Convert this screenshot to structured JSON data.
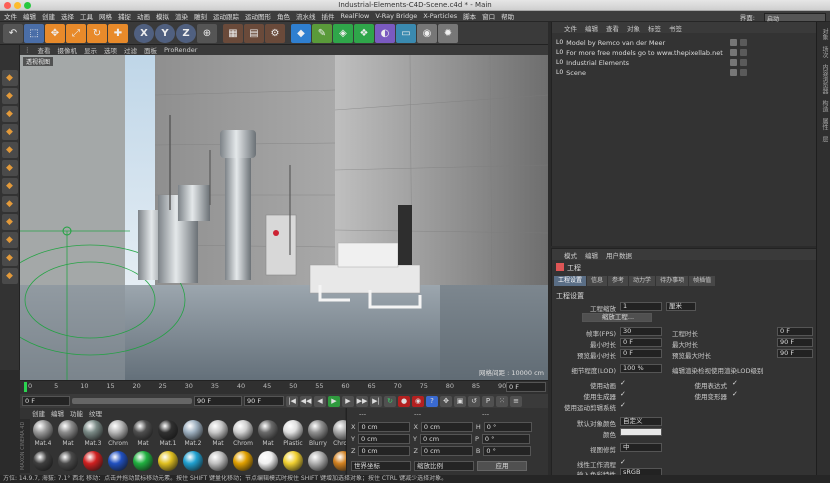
{
  "window": {
    "title": "Industrial-Elements-C4D-Scene.c4d * - Main"
  },
  "menubar": {
    "items": [
      "文件",
      "编辑",
      "创建",
      "选择",
      "工具",
      "网格",
      "捕捉",
      "动画",
      "模拟",
      "渲染",
      "雕刻",
      "运动跟踪",
      "运动图形",
      "角色",
      "流水线",
      "插件",
      "RealFlow",
      "V-Ray Bridge",
      "X-Particles",
      "脚本",
      "窗口",
      "帮助"
    ],
    "layout_label": "界面:",
    "layout_value": "启动"
  },
  "toolbar": {
    "icons": [
      "undo-icon",
      "select-live-icon",
      "move-icon",
      "scale-icon",
      "rotate-icon",
      "recent-tool-icon",
      "x-axis-icon",
      "y-axis-icon",
      "z-axis-icon",
      "world-coord-icon",
      "render-view-icon",
      "render-picture-viewer-icon",
      "render-settings-icon",
      "cube-icon",
      "spline-pen-icon",
      "subdivision-icon",
      "array-icon",
      "deformer-icon",
      "floor-icon",
      "camera-icon",
      "light-icon"
    ],
    "axis_labels": [
      "X",
      "Y",
      "Z"
    ]
  },
  "viewport": {
    "menu": [
      "查看",
      "摄像机",
      "显示",
      "选项",
      "过滤",
      "面板",
      "ProRender"
    ],
    "label": "透视视图",
    "grid_info": "网格间距 : 10000 cm"
  },
  "timeline": {
    "ticks": [
      "0",
      "5",
      "10",
      "15",
      "20",
      "25",
      "30",
      "35",
      "40",
      "45",
      "50",
      "55",
      "60",
      "65",
      "70",
      "75",
      "80",
      "85",
      "90"
    ],
    "frame_end": "0 F",
    "current_frame": "0 F",
    "start_frame": "0 F",
    "end_frame": "90 F",
    "end_frame2": "90 F"
  },
  "materials": {
    "menu": [
      "创建",
      "编辑",
      "功能",
      "纹理"
    ],
    "items": [
      {
        "label": "Mat.4",
        "color": "#9a9a9a"
      },
      {
        "label": "Mat",
        "color": "#8c8c8c"
      },
      {
        "label": "Mat.3",
        "color": "#7a8a86"
      },
      {
        "label": "Chrom",
        "color": "#b8b8b8"
      },
      {
        "label": "Mat",
        "color": "#4e4e4e"
      },
      {
        "label": "Mat.1",
        "color": "#303030"
      },
      {
        "label": "Mat.2",
        "color": "#9eb0c0"
      },
      {
        "label": "Mat",
        "color": "#c8c8c8"
      },
      {
        "label": "Chrom",
        "color": "#d0d0d0"
      },
      {
        "label": "Mat",
        "color": "#6a6a6a"
      },
      {
        "label": "Plastic",
        "color": "#e0e0e0"
      },
      {
        "label": "Blurry",
        "color": "#909090"
      },
      {
        "label": "Chrom",
        "color": "#a8a8a8"
      },
      {
        "label": "",
        "color": "#3e3e3e"
      },
      {
        "label": "",
        "color": "#4a4a4a"
      },
      {
        "label": "",
        "color": "#d02020"
      },
      {
        "label": "",
        "color": "#2050c0"
      },
      {
        "label": "",
        "color": "#20b040"
      },
      {
        "label": "",
        "color": "#e0c020"
      },
      {
        "label": "",
        "color": "#20a0d0"
      },
      {
        "label": "",
        "color": "#c0c0c0"
      },
      {
        "label": "",
        "color": "#e0a000"
      },
      {
        "label": "",
        "color": "#f0f0f0"
      },
      {
        "label": "",
        "color": "#f0d030"
      },
      {
        "label": "",
        "color": "#b0b0b0"
      },
      {
        "label": "",
        "color": "#d08020"
      }
    ],
    "brand": "MAXON CINEMA 4D"
  },
  "coords": {
    "header": [
      "---",
      "---",
      "---"
    ],
    "rows": [
      {
        "axis": "X",
        "pos": "0 cm",
        "axis2": "X",
        "size": "0 cm",
        "axis3": "H",
        "rot": "0 °"
      },
      {
        "axis": "Y",
        "pos": "0 cm",
        "axis2": "Y",
        "size": "0 cm",
        "axis3": "P",
        "rot": "0 °"
      },
      {
        "axis": "Z",
        "pos": "0 cm",
        "axis2": "Z",
        "size": "0 cm",
        "axis3": "B",
        "rot": "0 °"
      }
    ],
    "mode": "世界坐标",
    "scale_mode": "缩放比例",
    "apply": "应用"
  },
  "objects": {
    "menu": [
      "文件",
      "编辑",
      "查看",
      "对象",
      "标签",
      "书签"
    ],
    "items": [
      "Model by Remco van der Meer",
      "For more free models go to www.thepixellab.net",
      "Industrial Elements",
      "Scene"
    ]
  },
  "attributes": {
    "menu": [
      "模式",
      "编辑",
      "用户数据"
    ],
    "object_name": "工程",
    "tabs": [
      "工程设置",
      "信息",
      "参考",
      "动力学",
      "待办事项",
      "帧插值"
    ],
    "section": "工程设置",
    "project_scale_label": "工程缩放",
    "project_scale_value": "1",
    "project_scale_unit": "厘米",
    "scale_button": "缩放工程...",
    "fps_label": "帧率(FPS)",
    "fps_value": "30",
    "min_time_label": "最小时长",
    "min_time_value": "0 F",
    "preview_min_label": "预览最小时长",
    "preview_min_value": "0 F",
    "project_time_label": "工程时长",
    "project_time_value": "0 F",
    "max_time_label": "最大时长",
    "max_time_value": "90 F",
    "preview_max_label": "预览最大时长",
    "preview_max_value": "90 F",
    "lod_label": "细节程度(LOD)",
    "lod_value": "100 %",
    "lod_render_label": "编辑渲染检视使用渲染LOD级别",
    "use_anim_label": "使用动画",
    "use_expr_label": "使用表达式",
    "use_gen_label": "使用生成器",
    "use_deform_label": "使用变形器",
    "use_motion_label": "使用运动剪辑系统",
    "default_color_label": "默认对象颜色",
    "default_color_value": "自定义",
    "color_label": "颜色",
    "view_clip_label": "视图修剪",
    "view_clip_value": "中",
    "linear_label": "线性工作流程",
    "input_profile_label": "输入色彩特性",
    "input_profile_value": "sRGB"
  },
  "status": "方位: 14.9.7, 海拔: 7.1° 西北    移动：点击并拖动鼠标移动元素。按住 SHIFT 键量化移动；节点编辑模式时按住 SHIFT 键增加选择对象；按住 CTRL 键减少选择对象。",
  "right_strip": [
    "对象",
    "场次",
    "内容浏览器",
    "构造",
    "属性",
    "层"
  ]
}
